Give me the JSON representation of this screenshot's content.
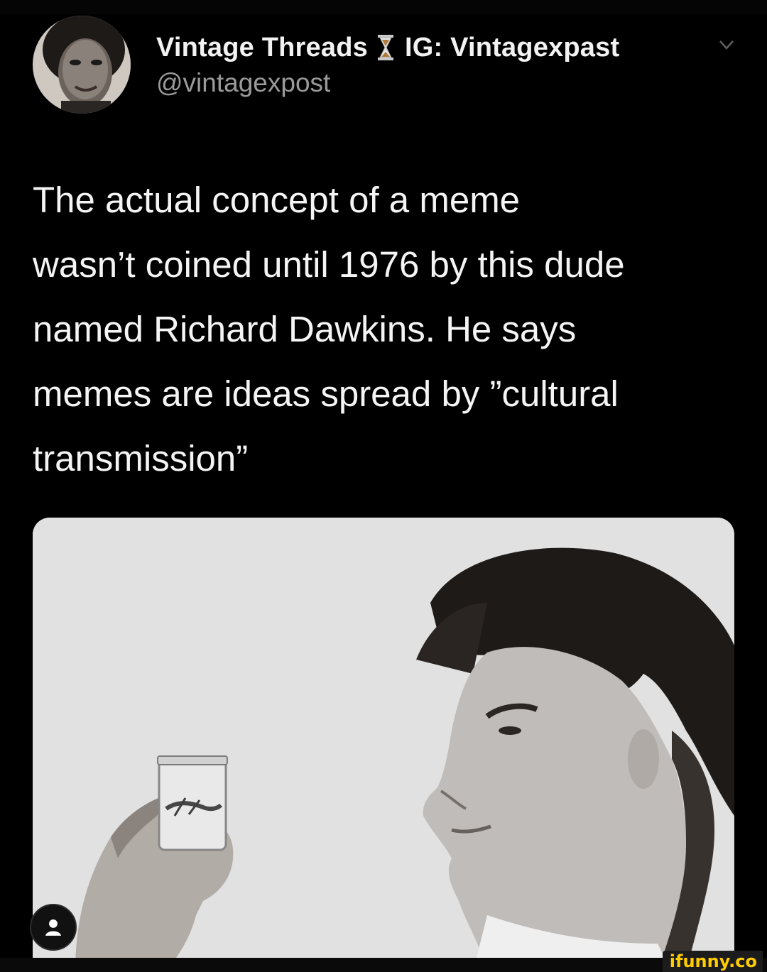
{
  "tweet": {
    "author": {
      "display_name": "Vintage Threads",
      "emoji_icon": "hourglass-icon",
      "display_name_suffix": "IG: Vintagexpast",
      "handle": "@vintagexpost"
    },
    "text_lines": [
      "The actual concept of a meme",
      "wasn’t coined until 1976 by this dude",
      "named Richard Dawkins. He says",
      "memes are ideas spread by ”cultural",
      "transmission”"
    ]
  },
  "watermark": "ifunny.co",
  "colors": {
    "background": "#000000",
    "text": "#f4f4f4",
    "handle": "#9a9a9a",
    "watermark": "#ffcc00"
  }
}
